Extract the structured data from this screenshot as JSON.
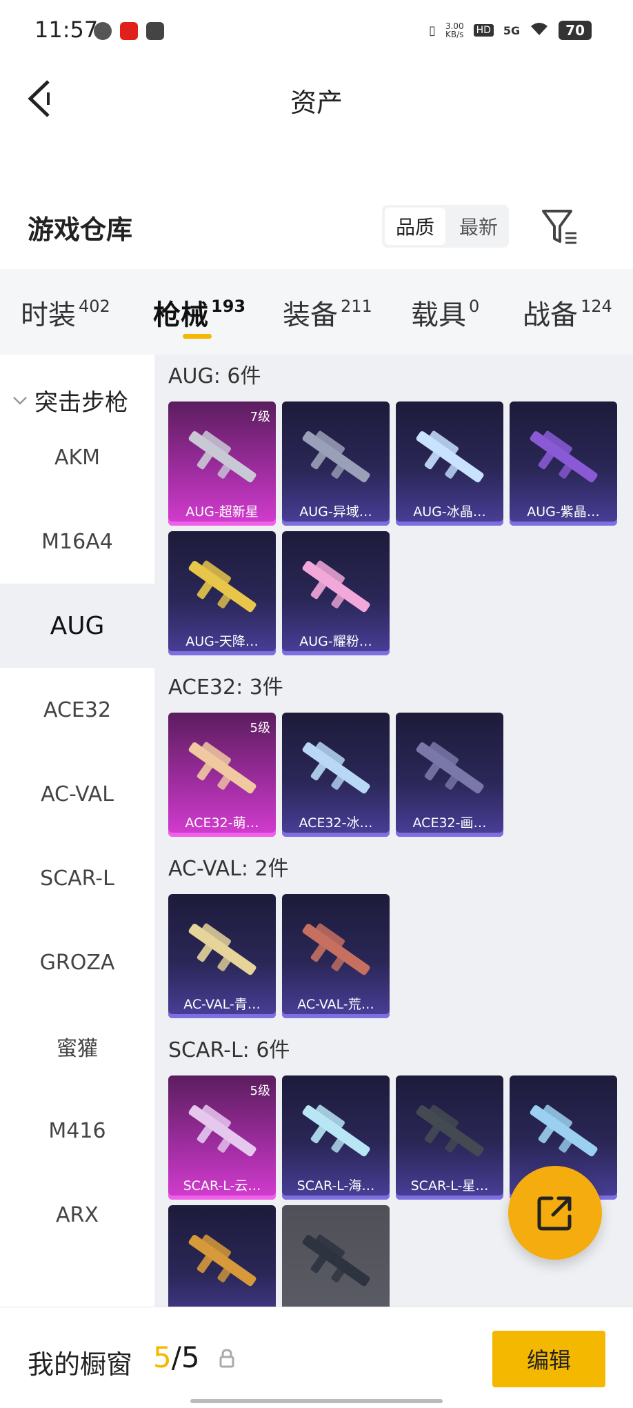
{
  "status_bar": {
    "time": "11:57",
    "network_speed": "3.00\nKB/s",
    "hd": "HD",
    "signal": "5G",
    "battery": "70"
  },
  "header": {
    "title": "资产"
  },
  "warehouse": {
    "title": "游戏仓库",
    "sort_options": [
      "品质",
      "最新"
    ],
    "active_sort": "品质"
  },
  "category_tabs": [
    {
      "label": "时装",
      "count": "402"
    },
    {
      "label": "枪械",
      "count": "193",
      "active": true
    },
    {
      "label": "装备",
      "count": "211"
    },
    {
      "label": "载具",
      "count": "0"
    },
    {
      "label": "战备",
      "count": "124"
    }
  ],
  "sidebar": {
    "header": "突击步枪",
    "items": [
      "AKM",
      "M16A4",
      "AUG",
      "ACE32",
      "AC-VAL",
      "SCAR-L",
      "GROZA",
      "蜜獾",
      "M416",
      "ARX"
    ],
    "selected": "AUG"
  },
  "groups": [
    {
      "title": "AUG: 6件",
      "items": [
        {
          "name": "AUG-超新星",
          "level": "7级",
          "rarity": "pink"
        },
        {
          "name": "AUG-异域…",
          "level": "",
          "rarity": "purple"
        },
        {
          "name": "AUG-冰晶…",
          "level": "",
          "rarity": "purple"
        },
        {
          "name": "AUG-紫晶…",
          "level": "",
          "rarity": "purple"
        },
        {
          "name": "AUG-天降…",
          "level": "",
          "rarity": "purple"
        },
        {
          "name": "AUG-耀粉…",
          "level": "",
          "rarity": "purple"
        }
      ]
    },
    {
      "title": "ACE32: 3件",
      "items": [
        {
          "name": "ACE32-萌…",
          "level": "5级",
          "rarity": "pink"
        },
        {
          "name": "ACE32-冰…",
          "level": "",
          "rarity": "purple"
        },
        {
          "name": "ACE32-画…",
          "level": "",
          "rarity": "purple"
        }
      ]
    },
    {
      "title": "AC-VAL: 2件",
      "items": [
        {
          "name": "AC-VAL-青…",
          "level": "",
          "rarity": "purple"
        },
        {
          "name": "AC-VAL-荒…",
          "level": "",
          "rarity": "purple"
        }
      ]
    },
    {
      "title": "SCAR-L: 6件",
      "items": [
        {
          "name": "SCAR-L-云…",
          "level": "5级",
          "rarity": "pink"
        },
        {
          "name": "SCAR-L-海…",
          "level": "",
          "rarity": "purple"
        },
        {
          "name": "SCAR-L-星…",
          "level": "",
          "rarity": "purple"
        },
        {
          "name": "…",
          "level": "",
          "rarity": "purple"
        },
        {
          "name": "",
          "level": "",
          "rarity": "purple"
        },
        {
          "name": "",
          "level": "",
          "rarity": "gray"
        }
      ]
    }
  ],
  "bottom_bar": {
    "label": "我的橱窗",
    "count_current": "5",
    "count_total": "/5",
    "edit_label": "编辑"
  },
  "colors": {
    "accent": "#f5b800",
    "fab": "#f5ac0f",
    "card_purple": "#2a2757",
    "card_pink": "#a32ea4"
  }
}
